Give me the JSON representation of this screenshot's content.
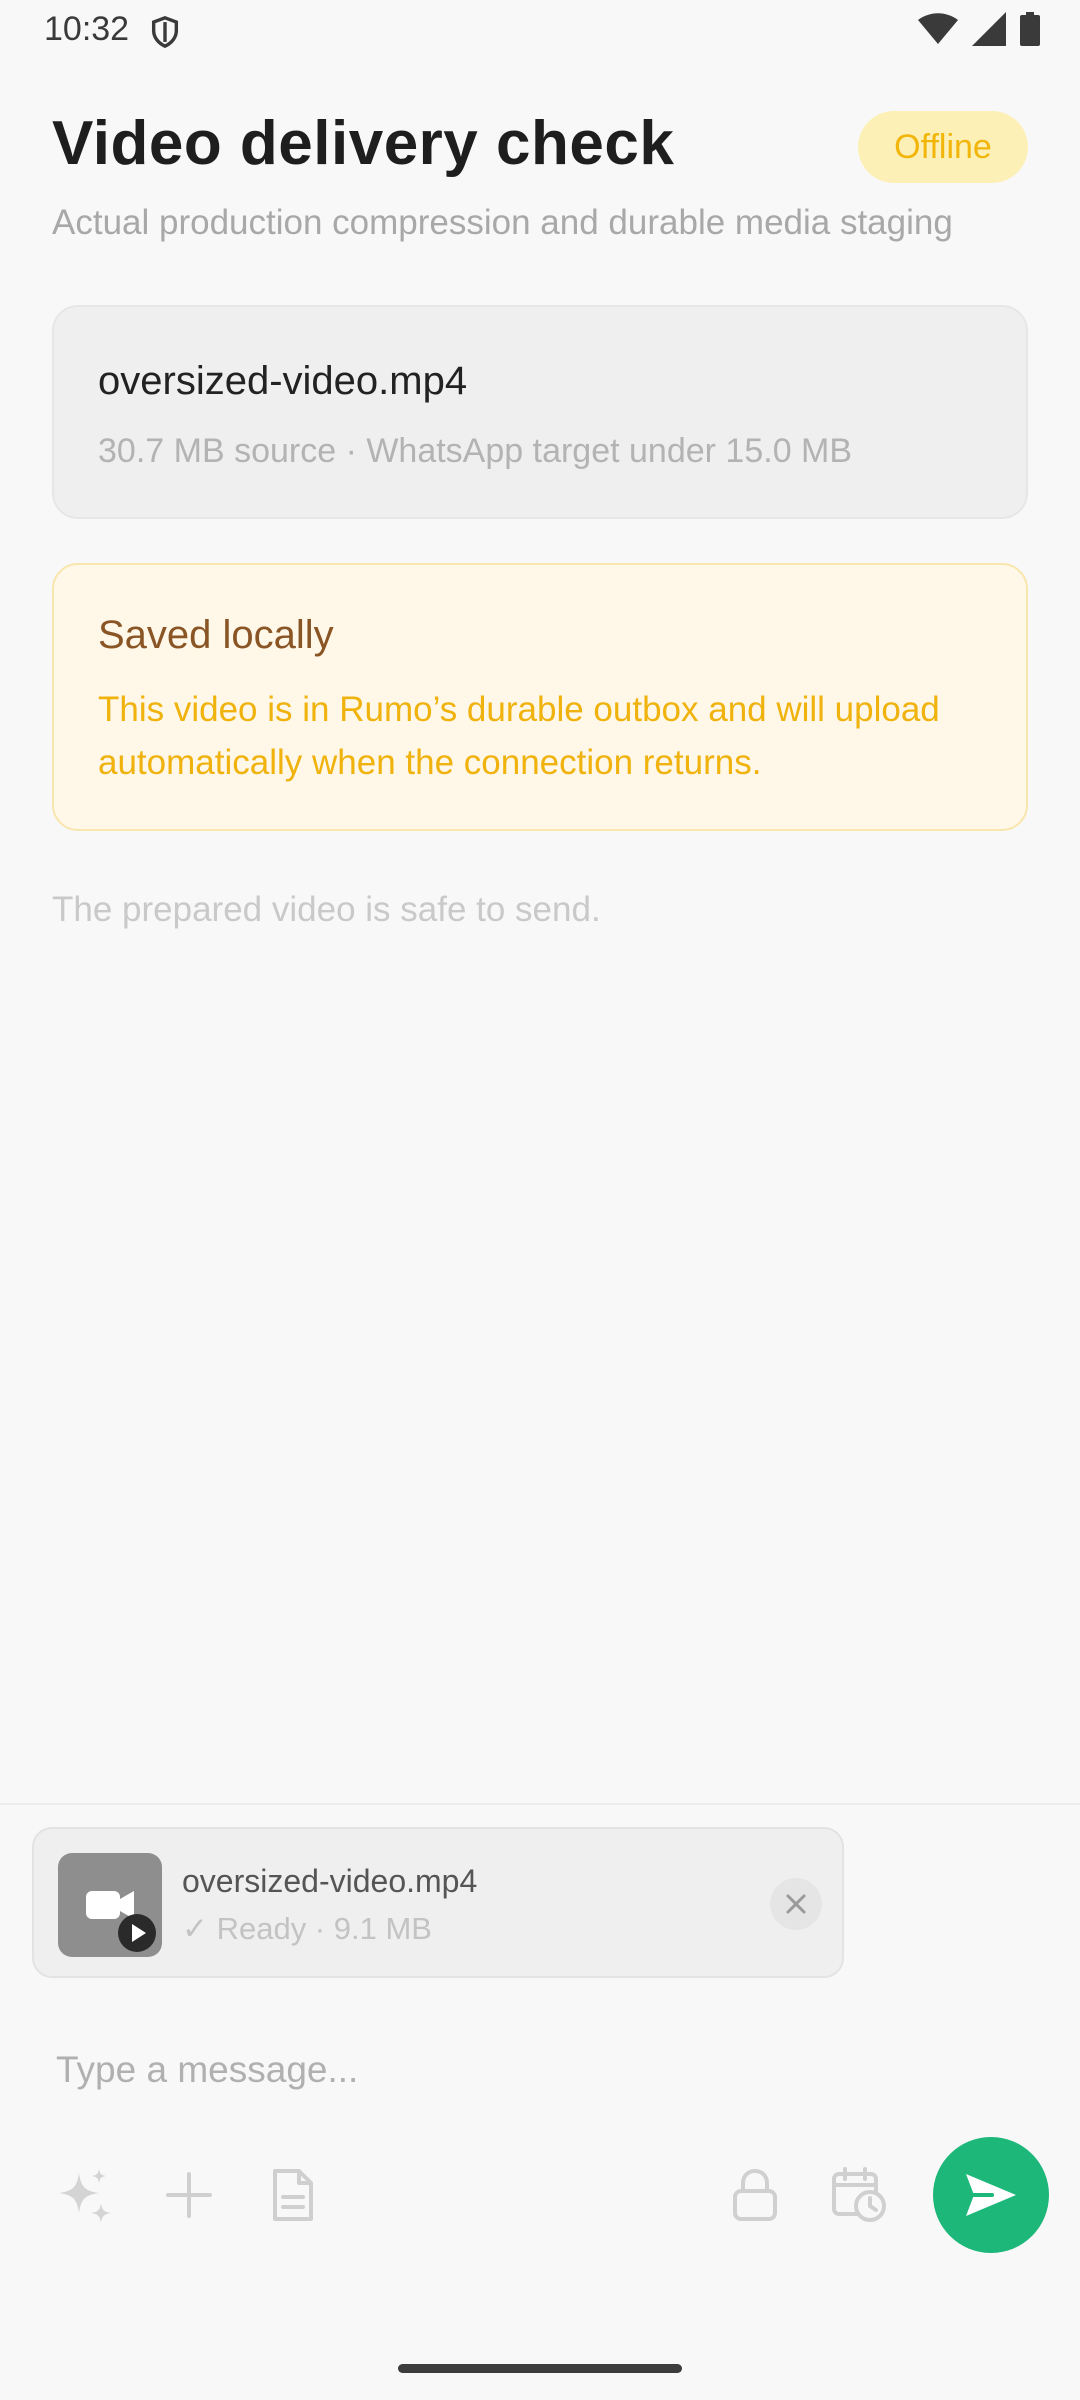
{
  "status_bar": {
    "time": "10:32",
    "icons": [
      "shield-icon",
      "wifi-icon",
      "signal-icon",
      "battery-icon"
    ]
  },
  "header": {
    "title": "Video delivery check",
    "status_badge": "Offline",
    "subtitle": "Actual production compression and durable media staging"
  },
  "file_card": {
    "name": "oversized-video.mp4",
    "meta": "30.7 MB source · WhatsApp target under 15.0 MB"
  },
  "notice": {
    "title": "Saved locally",
    "body": "This video is in Rumo’s durable outbox and will upload automatically when the connection returns."
  },
  "safe_message": "The prepared video is safe to send.",
  "composer": {
    "attachment": {
      "name": "oversized-video.mp4",
      "status": "✓ Ready · 9.1 MB",
      "thumb_icon": "video-camera-icon"
    },
    "input_placeholder": "Type a message...",
    "toolbar": [
      "sparkles-icon",
      "plus-icon",
      "document-icon",
      "lock-icon",
      "calendar-clock-icon",
      "send-icon"
    ]
  },
  "colors": {
    "background": "#f8f8f8",
    "offline_badge_bg": "#fdf0b6",
    "offline_badge_text": "#f2b50a",
    "notice_bg": "#fff7e8",
    "notice_title": "#8a5524",
    "notice_body": "#f0b20c",
    "send_button": "#1db77a"
  }
}
